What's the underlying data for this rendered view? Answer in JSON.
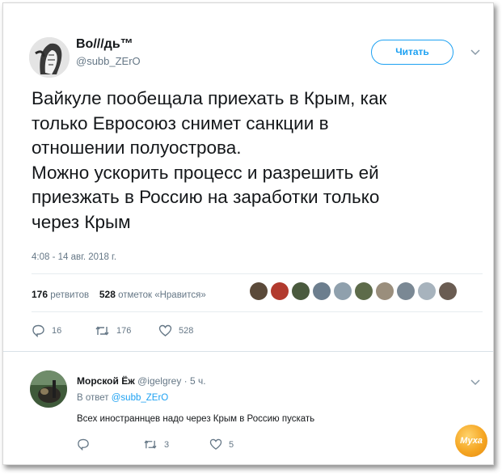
{
  "tweet": {
    "author_name": "Во///дь™",
    "author_handle": "@subb_ZErO",
    "follow_label": "Читать",
    "text_lines": [
      "Вайкуле пообещала приехать в Крым, как",
      "только Евросоюз снимет санкции в",
      "отношении полуострова.",
      "Можно ускорить процесс и разрешить ей",
      "приезжать в Россию на заработки только",
      "через Крым"
    ],
    "timestamp": "4:08 - 14 авг. 2018 г.",
    "retweets_count": "176",
    "retweets_label": "ретвитов",
    "likes_count": "528",
    "likes_label": "отметок «Нравится»",
    "reply_count": "16",
    "retweet_count": "176",
    "like_count": "528"
  },
  "reply": {
    "author_name": "Морской Ёж",
    "author_handle": "@igelgrey",
    "time": "· 5 ч.",
    "in_reply_to_prefix": "В ответ",
    "in_reply_to_handle": "@subb_ZErO",
    "text": "Всех иностраннцев надо через Крым в Россию пускать",
    "retweet_count": "3",
    "like_count": "5"
  },
  "watermark": "Муха",
  "colors": {
    "accent": "#1da1f2",
    "muted": "#657786",
    "text": "#14171a"
  }
}
